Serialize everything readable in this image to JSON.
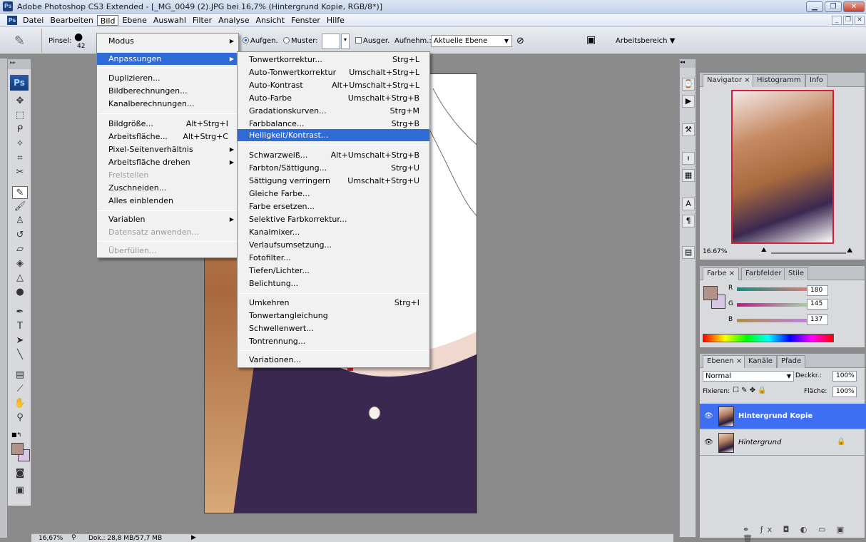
{
  "window": {
    "title": "Adobe Photoshop CS3 Extended - [_MG_0049 (2).JPG bei 16,7% (Hintergrund Kopie, RGB/8*)]",
    "app_badge": "Ps"
  },
  "menubar": {
    "items": [
      "Datei",
      "Bearbeiten",
      "Bild",
      "Ebene",
      "Auswahl",
      "Filter",
      "Analyse",
      "Ansicht",
      "Fenster",
      "Hilfe"
    ],
    "active": "Bild"
  },
  "options": {
    "brush_label": "Pinsel:",
    "brush_size": "42",
    "aligned_label": "Aufgen.",
    "pattern_label": "Muster:",
    "sample_label": "Ausger.",
    "sample_from_label": "Aufnehm.:",
    "sample_from_value": "Aktuelle Ebene",
    "workspace_label": "Arbeitsbereich"
  },
  "bild_menu": {
    "items": [
      {
        "label": "Modus",
        "arrow": true
      },
      {
        "label": "Anpassungen",
        "arrow": true,
        "highlighted": true
      },
      {
        "label": "Duplizieren..."
      },
      {
        "label": "Bildberechnungen..."
      },
      {
        "label": "Kanalberechnungen..."
      },
      {
        "label": "Bildgröße...",
        "shortcut": "Alt+Strg+I"
      },
      {
        "label": "Arbeitsfläche...",
        "shortcut": "Alt+Strg+C"
      },
      {
        "label": "Pixel-Seitenverhältnis",
        "arrow": true
      },
      {
        "label": "Arbeitsfläche drehen",
        "arrow": true
      },
      {
        "label": "Freistellen",
        "disabled": true
      },
      {
        "label": "Zuschneiden..."
      },
      {
        "label": "Alles einblenden"
      },
      {
        "label": "Variablen",
        "arrow": true
      },
      {
        "label": "Datensatz anwenden...",
        "disabled": true
      },
      {
        "label": "Überfüllen...",
        "disabled": true
      }
    ]
  },
  "adjust_menu": {
    "items": [
      {
        "label": "Tonwertkorrektur...",
        "shortcut": "Strg+L"
      },
      {
        "label": "Auto-Tonwertkorrektur",
        "shortcut": "Umschalt+Strg+L"
      },
      {
        "label": "Auto-Kontrast",
        "shortcut": "Alt+Umschalt+Strg+L"
      },
      {
        "label": "Auto-Farbe",
        "shortcut": "Umschalt+Strg+B"
      },
      {
        "label": "Gradationskurven...",
        "shortcut": "Strg+M"
      },
      {
        "label": "Farbbalance...",
        "shortcut": "Strg+B"
      },
      {
        "label": "Helligkeit/Kontrast...",
        "highlighted": true
      },
      {
        "label": "Schwarzweiß...",
        "shortcut": "Alt+Umschalt+Strg+B"
      },
      {
        "label": "Farbton/Sättigung...",
        "shortcut": "Strg+U"
      },
      {
        "label": "Sättigung verringern",
        "shortcut": "Umschalt+Strg+U"
      },
      {
        "label": "Gleiche Farbe..."
      },
      {
        "label": "Farbe ersetzen..."
      },
      {
        "label": "Selektive Farbkorrektur..."
      },
      {
        "label": "Kanalmixer..."
      },
      {
        "label": "Verlaufsumsetzung..."
      },
      {
        "label": "Fotofilter..."
      },
      {
        "label": "Tiefen/Lichter..."
      },
      {
        "label": "Belichtung..."
      },
      {
        "label": "Umkehren",
        "shortcut": "Strg+I"
      },
      {
        "label": "Tonwertangleichung"
      },
      {
        "label": "Schwellenwert..."
      },
      {
        "label": "Tontrennung..."
      },
      {
        "label": "Variationen..."
      }
    ]
  },
  "navigator": {
    "tabs": [
      "Navigator",
      "Histogramm",
      "Info"
    ],
    "zoom": "16.67%"
  },
  "color_panel": {
    "tabs": [
      "Farbe",
      "Farbfelder",
      "Stile"
    ],
    "r": {
      "label": "R",
      "value": "180"
    },
    "g": {
      "label": "G",
      "value": "145"
    },
    "b": {
      "label": "B",
      "value": "137"
    },
    "foreground": "#b49189",
    "background": "#d7c6e6"
  },
  "layers": {
    "tabs": [
      "Ebenen",
      "Kanäle",
      "Pfade"
    ],
    "blend_mode": "Normal",
    "opacity_label": "Deckkr.:",
    "opacity": "100%",
    "lock_label": "Fixieren:",
    "fill_label": "Fläche:",
    "fill": "100%",
    "items": [
      {
        "name": "Hintergrund Kopie",
        "selected": true
      },
      {
        "name": "Hintergrund",
        "locked": true
      }
    ]
  },
  "status": {
    "zoom": "16,67%",
    "doc": "Dok.: 28,8 MB/57,7 MB"
  }
}
